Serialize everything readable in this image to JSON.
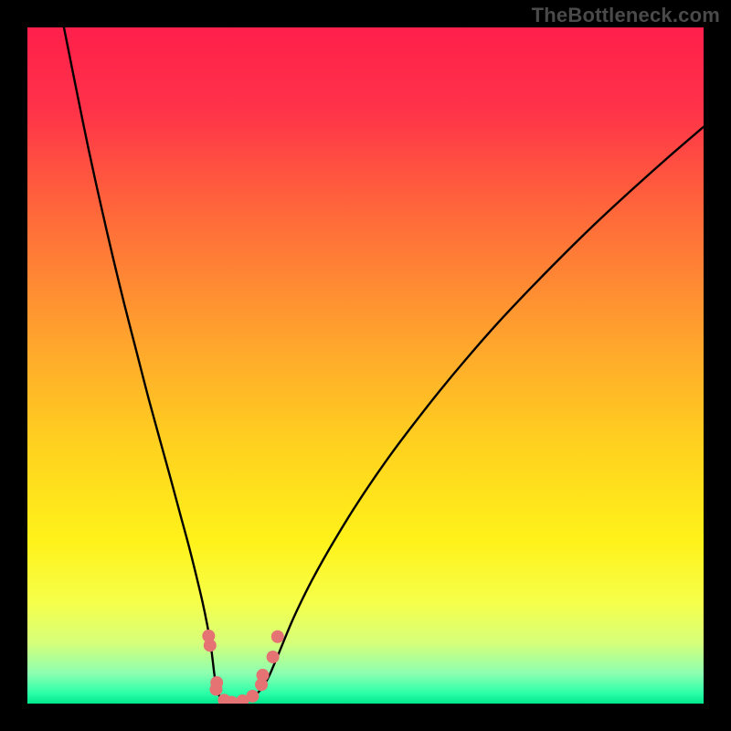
{
  "watermark": "TheBottleneck.com",
  "gradient_stops": [
    {
      "offset": 0.0,
      "color": "#ff1f4b"
    },
    {
      "offset": 0.12,
      "color": "#ff3249"
    },
    {
      "offset": 0.28,
      "color": "#ff6a3a"
    },
    {
      "offset": 0.45,
      "color": "#ffa02e"
    },
    {
      "offset": 0.62,
      "color": "#ffd21f"
    },
    {
      "offset": 0.76,
      "color": "#fff21a"
    },
    {
      "offset": 0.85,
      "color": "#f6ff4a"
    },
    {
      "offset": 0.91,
      "color": "#d6ff7a"
    },
    {
      "offset": 0.955,
      "color": "#8dffb0"
    },
    {
      "offset": 0.985,
      "color": "#2bffa8"
    },
    {
      "offset": 1.0,
      "color": "#00e58c"
    }
  ],
  "curve": {
    "stroke": "#000000",
    "stroke_width": 2.4,
    "points_left": [
      [
        0.054,
        0.0
      ],
      [
        0.072,
        0.09
      ],
      [
        0.09,
        0.178
      ],
      [
        0.108,
        0.26
      ],
      [
        0.126,
        0.338
      ],
      [
        0.144,
        0.412
      ],
      [
        0.162,
        0.482
      ],
      [
        0.179,
        0.548
      ],
      [
        0.196,
        0.61
      ],
      [
        0.212,
        0.668
      ],
      [
        0.226,
        0.72
      ],
      [
        0.239,
        0.768
      ],
      [
        0.25,
        0.812
      ],
      [
        0.259,
        0.85
      ],
      [
        0.266,
        0.884
      ],
      [
        0.271,
        0.913
      ],
      [
        0.274,
        0.936
      ],
      [
        0.276,
        0.953
      ],
      [
        0.278,
        0.967
      ],
      [
        0.28,
        0.978
      ],
      [
        0.283,
        0.987
      ],
      [
        0.288,
        0.994
      ],
      [
        0.295,
        0.998
      ],
      [
        0.305,
        1.0
      ]
    ],
    "points_right": [
      [
        0.305,
        1.0
      ],
      [
        0.318,
        0.998
      ],
      [
        0.33,
        0.993
      ],
      [
        0.34,
        0.985
      ],
      [
        0.349,
        0.974
      ],
      [
        0.357,
        0.96
      ],
      [
        0.364,
        0.944
      ],
      [
        0.372,
        0.925
      ],
      [
        0.381,
        0.903
      ],
      [
        0.391,
        0.879
      ],
      [
        0.404,
        0.851
      ],
      [
        0.419,
        0.821
      ],
      [
        0.437,
        0.788
      ],
      [
        0.458,
        0.752
      ],
      [
        0.482,
        0.713
      ],
      [
        0.509,
        0.672
      ],
      [
        0.54,
        0.628
      ],
      [
        0.574,
        0.583
      ],
      [
        0.611,
        0.536
      ],
      [
        0.651,
        0.488
      ],
      [
        0.694,
        0.439
      ],
      [
        0.74,
        0.39
      ],
      [
        0.789,
        0.34
      ],
      [
        0.84,
        0.29
      ],
      [
        0.894,
        0.24
      ],
      [
        0.95,
        0.19
      ],
      [
        1.0,
        0.147
      ]
    ]
  },
  "markers": {
    "fill": "#e57373",
    "radius": 7,
    "points": [
      [
        0.268,
        0.9
      ],
      [
        0.27,
        0.914
      ],
      [
        0.28,
        0.969
      ],
      [
        0.279,
        0.979
      ],
      [
        0.291,
        0.995
      ],
      [
        0.302,
        0.998
      ],
      [
        0.318,
        0.996
      ],
      [
        0.333,
        0.989
      ],
      [
        0.346,
        0.972
      ],
      [
        0.348,
        0.958
      ],
      [
        0.363,
        0.931
      ],
      [
        0.37,
        0.901
      ]
    ]
  },
  "chart_data": {
    "type": "line",
    "title": "",
    "xlabel": "",
    "ylabel": "",
    "xlim": [
      0,
      1
    ],
    "ylim": [
      0,
      1
    ],
    "note": "Normalized coordinates; x and y both span 0..1 of the plot area. y=1 is the bottom (green) edge, y=0 is the top (red) edge. The curve reaches its minimum (y≈1.0) near x≈0.30; markers cluster around that minimum.",
    "series": [
      {
        "name": "left-branch",
        "x": [
          0.054,
          0.072,
          0.09,
          0.108,
          0.126,
          0.144,
          0.162,
          0.179,
          0.196,
          0.212,
          0.226,
          0.239,
          0.25,
          0.259,
          0.266,
          0.271,
          0.274,
          0.276,
          0.278,
          0.28,
          0.283,
          0.288,
          0.295,
          0.305
        ],
        "y": [
          0.0,
          0.09,
          0.178,
          0.26,
          0.338,
          0.412,
          0.482,
          0.548,
          0.61,
          0.668,
          0.72,
          0.768,
          0.812,
          0.85,
          0.884,
          0.913,
          0.936,
          0.953,
          0.967,
          0.978,
          0.987,
          0.994,
          0.998,
          1.0
        ]
      },
      {
        "name": "right-branch",
        "x": [
          0.305,
          0.318,
          0.33,
          0.34,
          0.349,
          0.357,
          0.364,
          0.372,
          0.381,
          0.391,
          0.404,
          0.419,
          0.437,
          0.458,
          0.482,
          0.509,
          0.54,
          0.574,
          0.611,
          0.651,
          0.694,
          0.74,
          0.789,
          0.84,
          0.894,
          0.95,
          1.0
        ],
        "y": [
          1.0,
          0.998,
          0.993,
          0.985,
          0.974,
          0.96,
          0.944,
          0.925,
          0.903,
          0.879,
          0.851,
          0.821,
          0.788,
          0.752,
          0.713,
          0.672,
          0.628,
          0.583,
          0.536,
          0.488,
          0.439,
          0.39,
          0.34,
          0.29,
          0.24,
          0.19,
          0.147
        ]
      },
      {
        "name": "markers",
        "kind": "scatter",
        "x": [
          0.268,
          0.27,
          0.28,
          0.279,
          0.291,
          0.302,
          0.318,
          0.333,
          0.346,
          0.348,
          0.363,
          0.37
        ],
        "y": [
          0.9,
          0.914,
          0.969,
          0.979,
          0.995,
          0.998,
          0.996,
          0.989,
          0.972,
          0.958,
          0.931,
          0.901
        ]
      }
    ]
  }
}
